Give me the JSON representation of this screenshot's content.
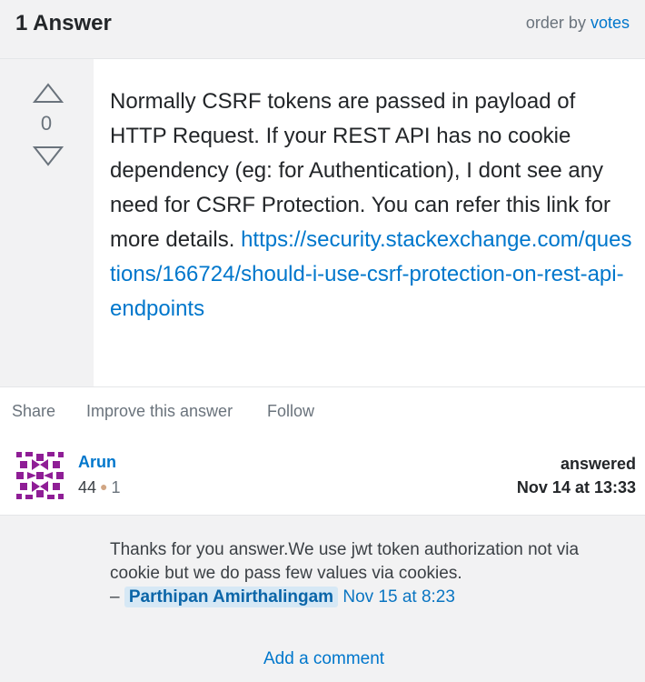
{
  "header": {
    "title": "1 Answer",
    "order_prefix": "order by",
    "order_value": "votes"
  },
  "answer": {
    "votes": "0",
    "body": "Normally CSRF tokens are passed in payload of HTTP Request. If your REST API has no cookie dependency (eg: for Authentication), I dont see any need for CSRF Protection. You can refer this link for more details.",
    "link": "https://security.stackexchange.com/questions/166724/should-i-use-csrf-protection-on-rest-api-endpoints"
  },
  "menu": {
    "share": "Share",
    "improve": "Improve this answer",
    "follow": "Follow"
  },
  "user": {
    "name": "Arun",
    "reputation": "44",
    "bronze": "1",
    "action": "answered",
    "date": "Nov 14 at 13:33"
  },
  "comment": {
    "text": "Thanks for you answer.We use jwt token authorization not via cookie but we do pass few values via cookies.",
    "dash": "–",
    "user": "Parthipan Amirthalingam",
    "date": "Nov 15 at 8:23"
  },
  "footer": {
    "add_comment": "Add a comment"
  },
  "colors": {
    "link": "#0077cc",
    "avatar": "#8f1e96",
    "bronze_dot": "#d1a684"
  }
}
